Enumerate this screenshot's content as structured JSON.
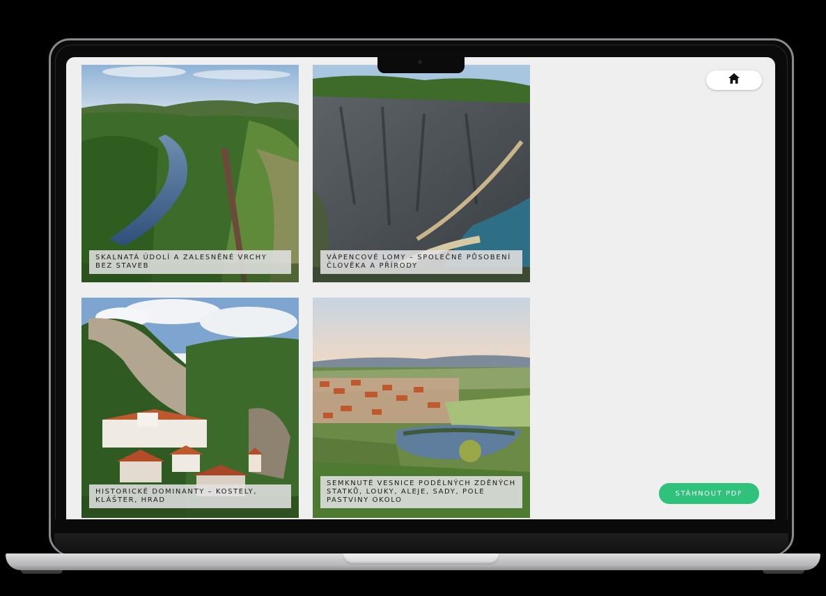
{
  "gallery": {
    "tiles": [
      {
        "caption": "SKALNATÁ ÚDOLÍ A ZALESNĚNÉ VRCHY BEZ STAVEB",
        "image": "river-valley-photo"
      },
      {
        "caption": "VÁPENCOVÉ LOMY – SPOLEČNÉ PŮSOBENÍ ČLOVĚKA A PŘÍRODY",
        "image": "limestone-quarry-photo"
      },
      {
        "caption": "HISTORICKÉ DOMINANTY – KOSTELY, KLÁŠTER, HRAD",
        "image": "monastery-rock-photo"
      },
      {
        "caption": "SEMKNUTÉ VESNICE PODÉLNÝCH ZDĚNÝCH STATKŮ, LOUKY, ALEJE, SADY, POLE PASTVINY OKOLO",
        "image": "village-pond-photo"
      }
    ]
  },
  "nav": {
    "home_icon": "home-icon"
  },
  "actions": {
    "download_pdf_label": "STÁHNOUT PDF"
  },
  "colors": {
    "accent": "#2ec27a",
    "screen_bg": "#efefef"
  }
}
